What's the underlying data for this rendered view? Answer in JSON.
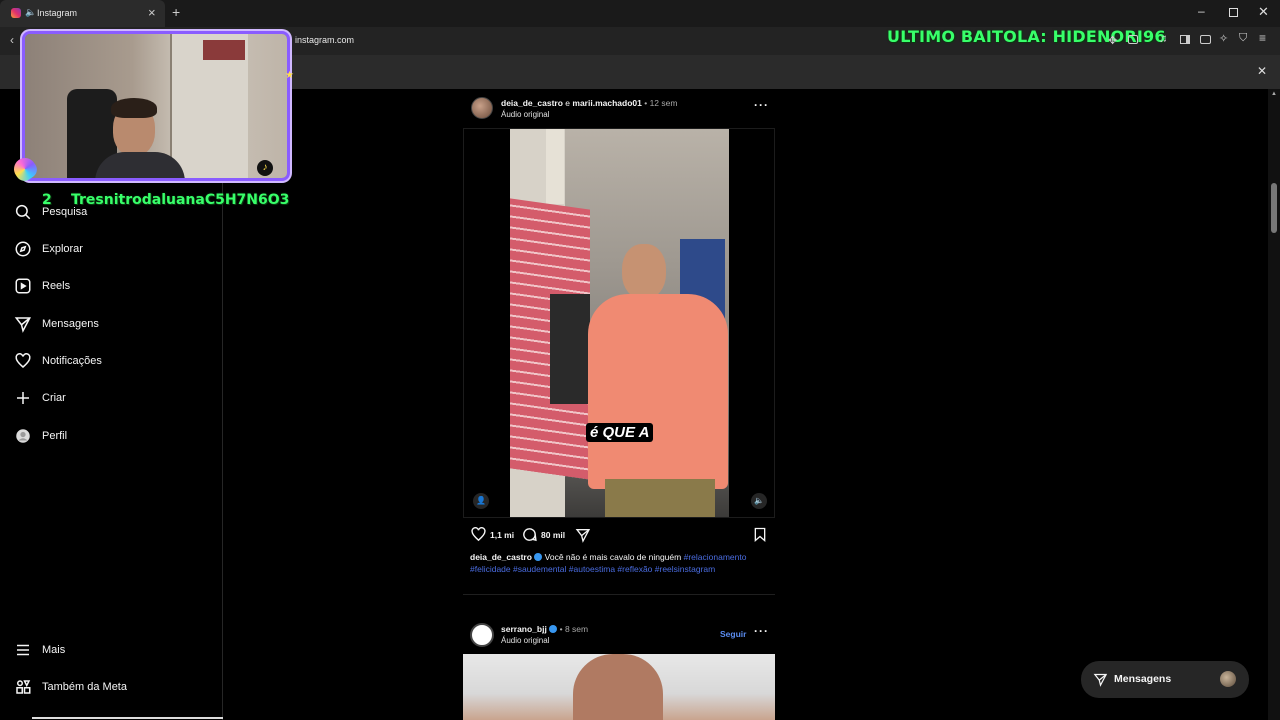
{
  "browser": {
    "tab_title": "Instagram",
    "url": "instagram.com",
    "new_tab": "+",
    "close_tab": "×"
  },
  "overlay": {
    "top_banner": "ULTIMO BAITOLA: HIDENORI96",
    "counter": "2",
    "ticker": "TresnitrodaluanaC5H7N6O3"
  },
  "sidebar": {
    "items": [
      {
        "label": "Pesquisa",
        "icon": "search-icon"
      },
      {
        "label": "Explorar",
        "icon": "compass-icon"
      },
      {
        "label": "Reels",
        "icon": "reels-icon"
      },
      {
        "label": "Mensagens",
        "icon": "send-icon"
      },
      {
        "label": "Notificações",
        "icon": "heart-icon"
      },
      {
        "label": "Criar",
        "icon": "plus-icon"
      },
      {
        "label": "Perfil",
        "icon": "avatar-icon"
      }
    ],
    "bottom": [
      {
        "label": "Mais",
        "icon": "menu-icon"
      },
      {
        "label": "Também da Meta",
        "icon": "meta-icon"
      }
    ]
  },
  "post1": {
    "user": "deia_de_castro",
    "connector": "e",
    "user2": "marii.machado01",
    "time": "12 sem",
    "dot": "•",
    "audio": "Áudio original",
    "caption_overlay": "é QUE A",
    "likes": "1,1 mi",
    "comments": "80 mil",
    "caption_user": "deia_de_castro",
    "caption_text": "Você não é mais cavalo de ninguém",
    "hashtags_line1": "#relacionamento",
    "hashtags_line2": "#felicidade #saudemental #autoestima #reflexão #reelsinstagram"
  },
  "post2": {
    "user": "serrano_bjj",
    "time": "8 sem",
    "dot": "•",
    "audio": "Áudio original",
    "follow": "Seguir"
  },
  "messages_button": {
    "label": "Mensagens"
  },
  "colors": {
    "background": "#000000",
    "neon_green": "#38ff6a",
    "link_blue": "#4a6ce0",
    "webcam_border": "#8a5cff"
  }
}
